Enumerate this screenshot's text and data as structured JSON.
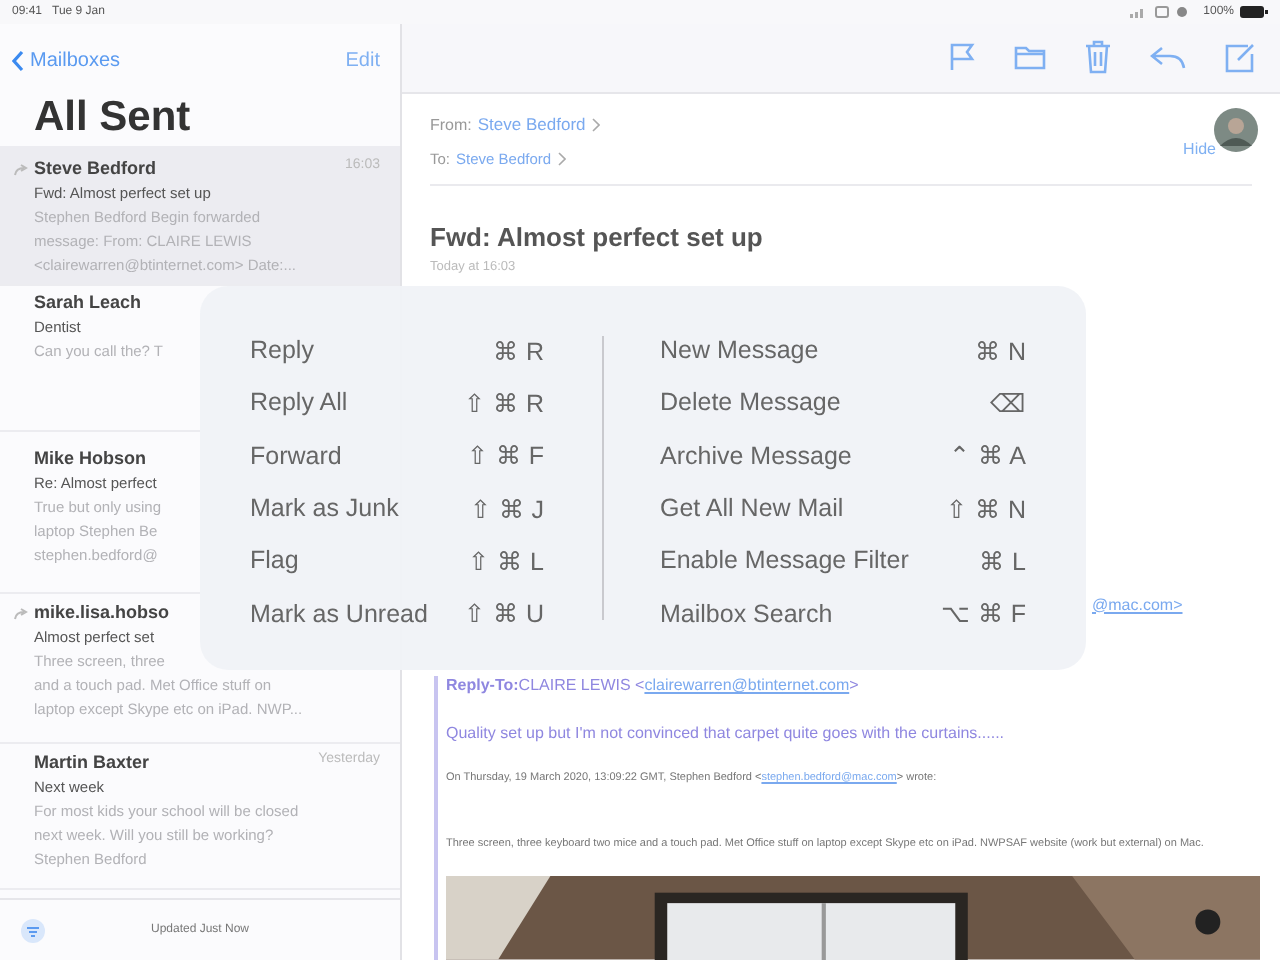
{
  "status_bar": {
    "time": "09:41",
    "date": "Tue 9 Jan",
    "battery": "100%"
  },
  "sidebar": {
    "back": "Mailboxes",
    "edit": "Edit",
    "title": "All Sent",
    "messages": [
      {
        "sender": "Steve Bedford",
        "time": "16:03",
        "subject": "Fwd: Almost perfect set up",
        "preview": [
          "Stephen Bedford Begin forwarded",
          "message: From: CLAIRE LEWIS",
          "<clairewarren@btinternet.com> Date:..."
        ],
        "selected": true,
        "forwarded": true
      },
      {
        "sender": "Sarah Leach",
        "subject": "Dentist",
        "preview": [
          "Can you call the? T"
        ],
        "selected": false,
        "forwarded": false
      },
      {
        "sender": "Mike Hobson",
        "subject": "Re: Almost perfect",
        "preview": [
          "True but only using",
          "laptop Stephen Be",
          "stephen.bedford@"
        ],
        "selected": false,
        "forwarded": false
      },
      {
        "sender": "mike.lisa.hobso",
        "subject": "Almost perfect set",
        "preview": [
          "Three screen, three",
          "and a touch pad. Met Office stuff on",
          "laptop except Skype etc on iPad. NWP..."
        ],
        "selected": false,
        "forwarded": true
      },
      {
        "sender": "Martin Baxter",
        "time": "Yesterday",
        "subject": "Next week",
        "preview": [
          "For most kids your school will be closed",
          "next week. Will you still be working?",
          "Stephen Bedford"
        ],
        "selected": false,
        "forwarded": false
      }
    ],
    "footer": "Updated Just Now"
  },
  "message": {
    "from_label": "From:",
    "from": "Steve Bedford",
    "to_label": "To:",
    "to": "Steve Bedford",
    "hide": "Hide",
    "subject": "Fwd: Almost perfect set up",
    "date": "Today at 16:03",
    "cut_link": "@mac.com>",
    "reply_to_label": "Reply-To:",
    "reply_to_name": "CLAIRE LEWIS <",
    "reply_to_link": "clairewarren@btinternet.com",
    "reply_to_end": ">",
    "quote": "Quality set up but I'm not convinced that carpet quite goes with the curtains......",
    "wrote_start": "On Thursday, 19 March 2020, 13:09:22 GMT, Stephen Bedford <",
    "wrote_link": "stephen.bedford@mac.com",
    "wrote_end": "> wrote:",
    "body": "Three screen, three keyboard two mice and a touch pad. Met Office stuff on laptop except Skype etc on iPad. NWPSAF website (work but external) on Mac."
  },
  "shortcuts": {
    "columns": [
      [
        {
          "label": "Reply",
          "keys": "⌘ R"
        },
        {
          "label": "Reply All",
          "keys": "⇧ ⌘ R"
        },
        {
          "label": "Forward",
          "keys": "⇧ ⌘ F"
        },
        {
          "label": "Mark as Junk",
          "keys": "⇧ ⌘ J"
        },
        {
          "label": "Flag",
          "keys": "⇧ ⌘ L"
        },
        {
          "label": "Mark as Unread",
          "keys": "⇧ ⌘ U"
        }
      ],
      [
        {
          "label": "New Message",
          "keys": "⌘ N"
        },
        {
          "label": "Delete Message",
          "keys": "⌫"
        },
        {
          "label": "Archive Message",
          "keys": "⌃ ⌘ A"
        },
        {
          "label": "Get All New Mail",
          "keys": "⇧ ⌘ N"
        },
        {
          "label": "Enable Message Filter",
          "keys": "⌘ L"
        },
        {
          "label": "Mailbox Search",
          "keys": "⌥ ⌘ F"
        }
      ]
    ]
  }
}
